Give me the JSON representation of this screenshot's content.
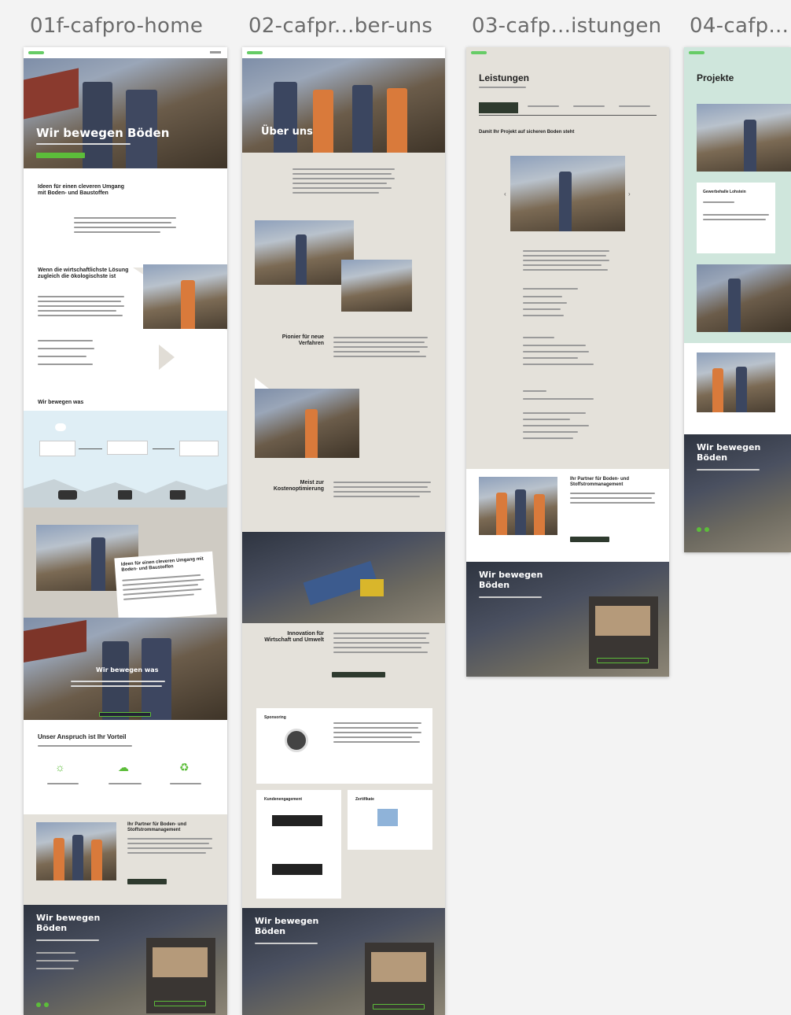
{
  "artboards": [
    {
      "label": "01f-cafpro-home",
      "hero_title": "Wir bewegen Böden",
      "section_heading": "Ideen für einen cleveren Umgang mit Boden- und Baustoffen",
      "section2_heading": "Wenn die wirtschaftlichste Lösung zugleich die ökologischste ist",
      "flow_heading": "Wir bewegen was",
      "card_heading": "Ideen für einen cleveren Umgang mit Boden- und Baustoffen",
      "banner_title": "Wir bewegen was",
      "claim_heading": "Unser Anspruch ist Ihr Vorteil",
      "partner_heading": "Ihr Partner für Boden- und Stoffstrommanagement",
      "footer_title": "Wir bewegen Böden"
    },
    {
      "label": "02-cafpr...ber-uns",
      "hero_title": "Über uns",
      "heading1": "Pionier für neue Verfahren",
      "heading2": "Meist zur Kostenoptimierung",
      "heading3": "Innovation für Wirtschaft und Umwelt",
      "box1": "Sponsoring",
      "box2": "Kundenengagement",
      "box3": "Zertifikate",
      "footer_title": "Wir bewegen Böden"
    },
    {
      "label": "03-cafp...istungen",
      "page_title": "Leistungen",
      "subheading": "Damit Ihr Projekt auf sicheren Boden steht",
      "partner_heading": "Ihr Partner für Boden- und Stoffstrommanagement",
      "footer_title": "Wir bewegen Böden"
    },
    {
      "label": "04-cafp...",
      "page_title": "Projekte",
      "card_heading": "Gewerbehalle Lohstein",
      "footer_title": "Wir bewegen Böden"
    }
  ],
  "colors": {
    "accent_green": "#5cbd3a",
    "beige": "#e4e1da",
    "mint": "#cfe6dc",
    "dark": "#3a3a38"
  }
}
